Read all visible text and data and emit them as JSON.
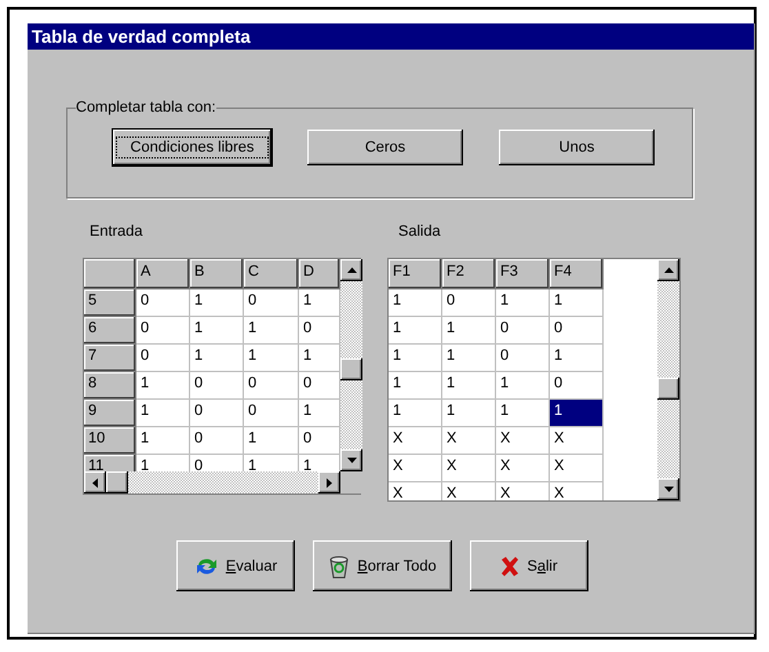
{
  "window": {
    "title": "Tabla de verdad completa"
  },
  "fill_group": {
    "label": "Completar tabla con:",
    "buttons": [
      {
        "label": "Condiciones libres",
        "default": true
      },
      {
        "label": "Ceros",
        "default": false
      },
      {
        "label": "Unos",
        "default": false
      }
    ]
  },
  "input_table": {
    "label": "Entrada",
    "columns": [
      "A",
      "B",
      "C",
      "D"
    ],
    "rows": [
      {
        "index": "5",
        "values": [
          "0",
          "1",
          "0",
          "1"
        ]
      },
      {
        "index": "6",
        "values": [
          "0",
          "1",
          "1",
          "0"
        ]
      },
      {
        "index": "7",
        "values": [
          "0",
          "1",
          "1",
          "1"
        ]
      },
      {
        "index": "8",
        "values": [
          "1",
          "0",
          "0",
          "0"
        ]
      },
      {
        "index": "9",
        "values": [
          "1",
          "0",
          "0",
          "1"
        ]
      },
      {
        "index": "10",
        "values": [
          "1",
          "0",
          "1",
          "0"
        ]
      },
      {
        "index": "11",
        "values": [
          "1",
          "0",
          "1",
          "1"
        ]
      }
    ]
  },
  "output_table": {
    "label": "Salida",
    "columns": [
      "F1",
      "F2",
      "F3",
      "F4"
    ],
    "rows": [
      [
        {
          "value": "1",
          "selected": false
        },
        {
          "value": "0",
          "selected": false
        },
        {
          "value": "1",
          "selected": false
        },
        {
          "value": "1",
          "selected": false
        }
      ],
      [
        {
          "value": "1",
          "selected": false
        },
        {
          "value": "1",
          "selected": false
        },
        {
          "value": "0",
          "selected": false
        },
        {
          "value": "0",
          "selected": false
        }
      ],
      [
        {
          "value": "1",
          "selected": false
        },
        {
          "value": "1",
          "selected": false
        },
        {
          "value": "0",
          "selected": false
        },
        {
          "value": "1",
          "selected": false
        }
      ],
      [
        {
          "value": "1",
          "selected": false
        },
        {
          "value": "1",
          "selected": false
        },
        {
          "value": "1",
          "selected": false
        },
        {
          "value": "0",
          "selected": false
        }
      ],
      [
        {
          "value": "1",
          "selected": false
        },
        {
          "value": "1",
          "selected": false
        },
        {
          "value": "1",
          "selected": false
        },
        {
          "value": "1",
          "selected": true
        }
      ],
      [
        {
          "value": "X",
          "selected": false
        },
        {
          "value": "X",
          "selected": false
        },
        {
          "value": "X",
          "selected": false
        },
        {
          "value": "X",
          "selected": false
        }
      ],
      [
        {
          "value": "X",
          "selected": false
        },
        {
          "value": "X",
          "selected": false
        },
        {
          "value": "X",
          "selected": false
        },
        {
          "value": "X",
          "selected": false
        }
      ],
      [
        {
          "value": "X",
          "selected": false
        },
        {
          "value": "X",
          "selected": false
        },
        {
          "value": "X",
          "selected": false
        },
        {
          "value": "X",
          "selected": false
        }
      ]
    ]
  },
  "actions": [
    {
      "kind": "evaluate",
      "key": "E",
      "after": "valuar"
    },
    {
      "kind": "clear",
      "key": "B",
      "after": "orrar Todo"
    },
    {
      "kind": "exit",
      "before": "S",
      "key": "a",
      "after": "lir"
    }
  ]
}
